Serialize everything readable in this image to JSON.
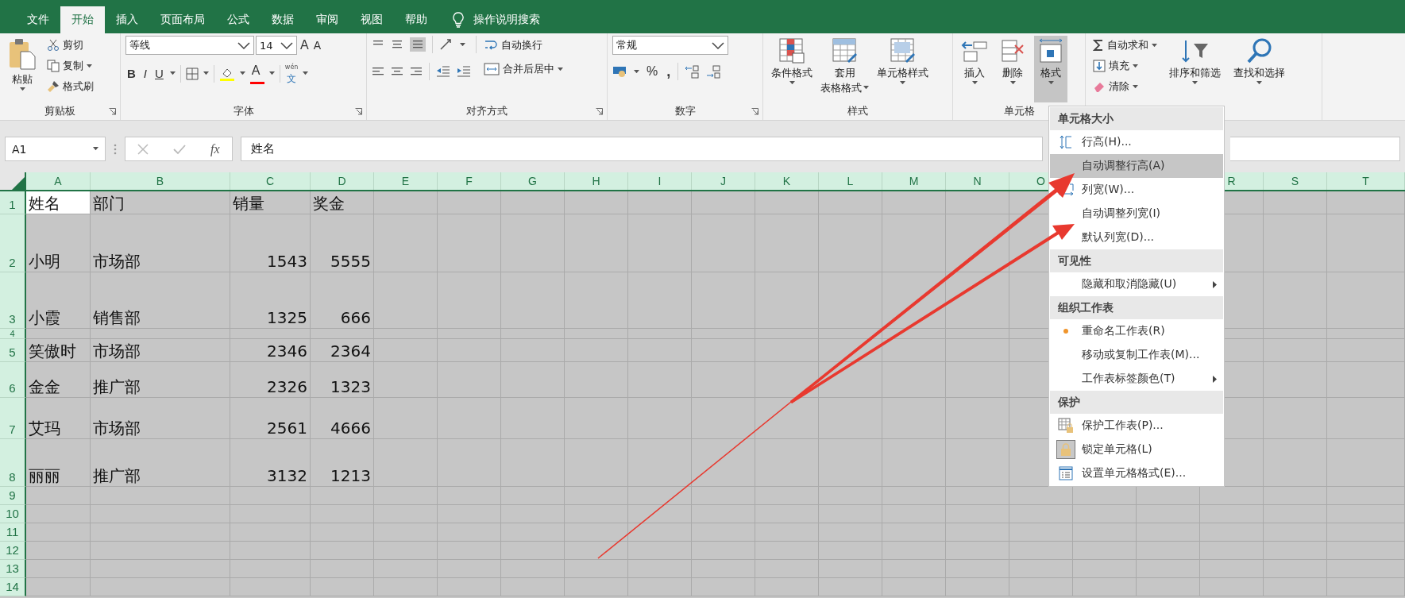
{
  "tabs": [
    {
      "label": "文件",
      "selected": false
    },
    {
      "label": "开始",
      "selected": true
    },
    {
      "label": "插入",
      "selected": false
    },
    {
      "label": "页面布局",
      "selected": false
    },
    {
      "label": "公式",
      "selected": false
    },
    {
      "label": "数据",
      "selected": false
    },
    {
      "label": "审阅",
      "selected": false
    },
    {
      "label": "视图",
      "selected": false
    },
    {
      "label": "帮助",
      "selected": false
    }
  ],
  "tell_me": "操作说明搜索",
  "ribbon": {
    "clipboard": {
      "label": "剪贴板",
      "paste": "粘贴",
      "cut": "剪切",
      "copy": "复制",
      "format_painter": "格式刷"
    },
    "font": {
      "label": "字体",
      "font_name": "等线",
      "font_size": "14",
      "grow": "A",
      "shrink": "A",
      "bold": "B",
      "italic": "I",
      "underline": "U",
      "font_color": "A",
      "phonetic_top": "wén",
      "phonetic": "文"
    },
    "alignment": {
      "label": "对齐方式",
      "wrap_text": "自动换行",
      "merge_center": "合并后居中"
    },
    "number": {
      "label": "数字",
      "format": "常规",
      "percent": "%",
      "comma": ","
    },
    "styles": {
      "label": "样式",
      "conditional": "条件格式",
      "table_format_1": "套用",
      "table_format_2": "表格格式",
      "cell_styles": "单元格样式"
    },
    "cells": {
      "label": "单元格",
      "insert": "插入",
      "delete": "删除",
      "format": "格式",
      "format_open": true
    },
    "editing": {
      "autosum": "自动求和",
      "fill": "填充",
      "clear": "清除",
      "sort_filter": "排序和筛选",
      "find_select": "查找和选择"
    }
  },
  "formula_bar": {
    "name_box": "A1",
    "fx": "fx",
    "value": "姓名"
  },
  "sheet": {
    "all_selected": true,
    "columns": [
      "A",
      "B",
      "C",
      "D",
      "E",
      "F",
      "G",
      "H",
      "I",
      "J",
      "K",
      "L",
      "M",
      "N",
      "O"
    ],
    "columns_right": [
      "R",
      "S",
      "T"
    ],
    "rows": [
      {
        "number": "1",
        "kind": "header",
        "name": "姓名",
        "dept": "部门",
        "sales": "销量",
        "bonus": "奖金"
      },
      {
        "number": "2",
        "kind": "data",
        "name": "小明",
        "dept": "市场部",
        "sales": "1543",
        "bonus": "5555"
      },
      {
        "number": "3",
        "kind": "data",
        "name": "小霞",
        "dept": "销售部",
        "sales": "1325",
        "bonus": "666"
      },
      {
        "number": "4",
        "kind": "data"
      },
      {
        "number": "5",
        "kind": "data",
        "name": "笑傲时",
        "dept": "市场部",
        "sales": "2346",
        "bonus": "2364"
      },
      {
        "number": "6",
        "kind": "data",
        "name": "金金",
        "dept": "推广部",
        "sales": "2326",
        "bonus": "1323"
      },
      {
        "number": "7",
        "kind": "data",
        "name": "艾玛",
        "dept": "市场部",
        "sales": "2561",
        "bonus": "4666"
      },
      {
        "number": "8",
        "kind": "data",
        "name": "丽丽",
        "dept": "推广部",
        "sales": "3132",
        "bonus": "1213"
      },
      {
        "number": "9",
        "kind": "data"
      },
      {
        "number": "10",
        "kind": "data"
      },
      {
        "number": "11",
        "kind": "data"
      },
      {
        "number": "12",
        "kind": "data"
      },
      {
        "number": "13",
        "kind": "data"
      },
      {
        "number": "14",
        "kind": "data"
      }
    ]
  },
  "format_menu": [
    {
      "kind": "header",
      "label": "单元格大小"
    },
    {
      "kind": "item",
      "label": "行高(H)...",
      "selected": false,
      "checked": false,
      "submenu": false
    },
    {
      "kind": "item",
      "label": "自动调整行高(A)",
      "selected": true,
      "checked": false,
      "submenu": false
    },
    {
      "kind": "item",
      "label": "列宽(W)...",
      "selected": false,
      "checked": false,
      "submenu": false
    },
    {
      "kind": "item",
      "label": "自动调整列宽(I)",
      "selected": false,
      "checked": false,
      "submenu": false
    },
    {
      "kind": "item",
      "label": "默认列宽(D)...",
      "selected": false,
      "checked": false,
      "submenu": false
    },
    {
      "kind": "header",
      "label": "可见性"
    },
    {
      "kind": "item",
      "label": "隐藏和取消隐藏(U)",
      "selected": false,
      "checked": false,
      "submenu": true
    },
    {
      "kind": "header",
      "label": "组织工作表"
    },
    {
      "kind": "item",
      "label": "重命名工作表(R)",
      "selected": false,
      "checked": false,
      "submenu": false
    },
    {
      "kind": "item",
      "label": "移动或复制工作表(M)...",
      "selected": false,
      "checked": false,
      "submenu": false
    },
    {
      "kind": "item",
      "label": "工作表标签颜色(T)",
      "selected": false,
      "checked": false,
      "submenu": true
    },
    {
      "kind": "header",
      "label": "保护"
    },
    {
      "kind": "item",
      "label": "保护工作表(P)...",
      "selected": false,
      "checked": false,
      "submenu": false
    },
    {
      "kind": "item",
      "label": "锁定单元格(L)",
      "selected": false,
      "checked": true,
      "submenu": false
    },
    {
      "kind": "item",
      "label": "设置单元格格式(E)...",
      "selected": false,
      "checked": false,
      "submenu": false
    }
  ]
}
